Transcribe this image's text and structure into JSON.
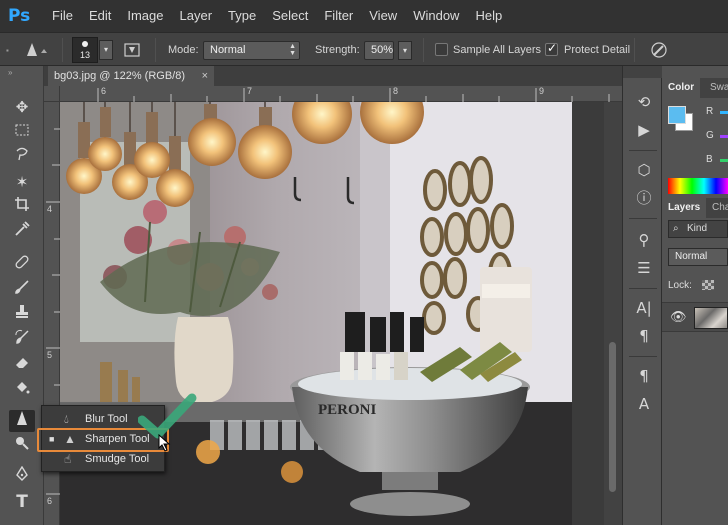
{
  "app": {
    "logo": "Ps"
  },
  "menu": [
    "File",
    "Edit",
    "Image",
    "Layer",
    "Type",
    "Select",
    "Filter",
    "View",
    "Window",
    "Help"
  ],
  "options": {
    "brush_size": "13",
    "mode_label": "Mode:",
    "mode_value": "Normal",
    "strength_label": "Strength:",
    "strength_value": "50%",
    "sample_all_layers": {
      "label": "Sample All Layers",
      "checked": false
    },
    "protect_detail": {
      "label": "Protect Detail",
      "checked": true
    }
  },
  "document": {
    "tab_title": "bg03.jpg @ 122% (RGB/8)",
    "close_glyph": "×"
  },
  "rulers": {
    "top": [
      "6",
      "7",
      "8",
      "9"
    ],
    "left": [
      "4",
      "5",
      "6"
    ]
  },
  "flyout": {
    "items": [
      {
        "label": "Blur Tool",
        "icon": "blur-drop-icon",
        "selected": false
      },
      {
        "label": "Sharpen Tool",
        "icon": "sharpen-triangle-icon",
        "selected": true
      },
      {
        "label": "Smudge Tool",
        "icon": "smudge-finger-icon",
        "selected": false
      }
    ],
    "highlight_color": "#e88a3a",
    "check_color": "#3aa77a"
  },
  "panels": {
    "color_tabs": [
      "Color",
      "Swa"
    ],
    "rgb_labels": [
      "R",
      "G",
      "B"
    ],
    "foreground_color": "#5bbcf0",
    "background_color": "#ffffff",
    "layers_tabs": [
      "Layers",
      "Cha"
    ],
    "kind_label": "Kind",
    "blend_mode": "Normal",
    "lock_label": "Lock:"
  }
}
